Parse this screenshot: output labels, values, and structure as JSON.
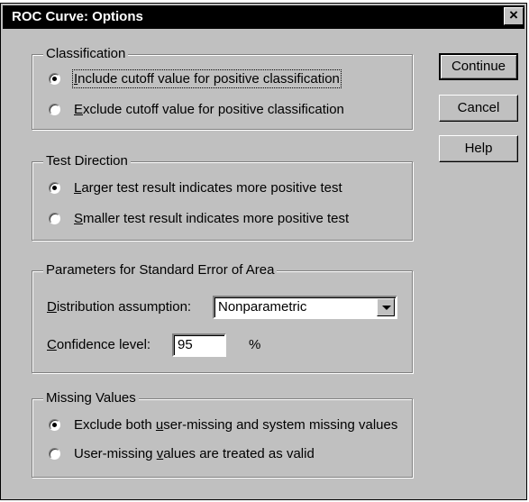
{
  "window": {
    "title": "ROC Curve: Options",
    "close_glyph": "×"
  },
  "buttons": {
    "continue": "Continue",
    "cancel": "Cancel",
    "help": "Help"
  },
  "classification": {
    "legend": "Classification",
    "options": [
      {
        "key": "I",
        "rest": "nclude cutoff value for positive classification",
        "selected": true
      },
      {
        "key": "E",
        "rest": "xclude cutoff value for positive classification",
        "selected": false
      }
    ]
  },
  "test_direction": {
    "legend": "Test Direction",
    "options": [
      {
        "key": "L",
        "rest": "arger test result indicates more positive test",
        "selected": true
      },
      {
        "key": "S",
        "rest": "maller test result indicates more positive test",
        "selected": false
      }
    ]
  },
  "std_error": {
    "legend": "Parameters for Standard Error of Area",
    "distribution_label_key": "D",
    "distribution_label_rest": "istribution assumption:",
    "distribution_value": "Nonparametric",
    "confidence_label_key": "C",
    "confidence_label_rest": "onfidence level:",
    "confidence_value": "95",
    "percent_sign": "%"
  },
  "missing_values": {
    "legend": "Missing Values",
    "options": [
      {
        "pre": "Exclude both ",
        "key": "u",
        "rest": "ser-missing and system missing values",
        "selected": true
      },
      {
        "pre": "User-missing ",
        "key": "v",
        "rest": "alues are treated as valid",
        "selected": false
      }
    ]
  }
}
